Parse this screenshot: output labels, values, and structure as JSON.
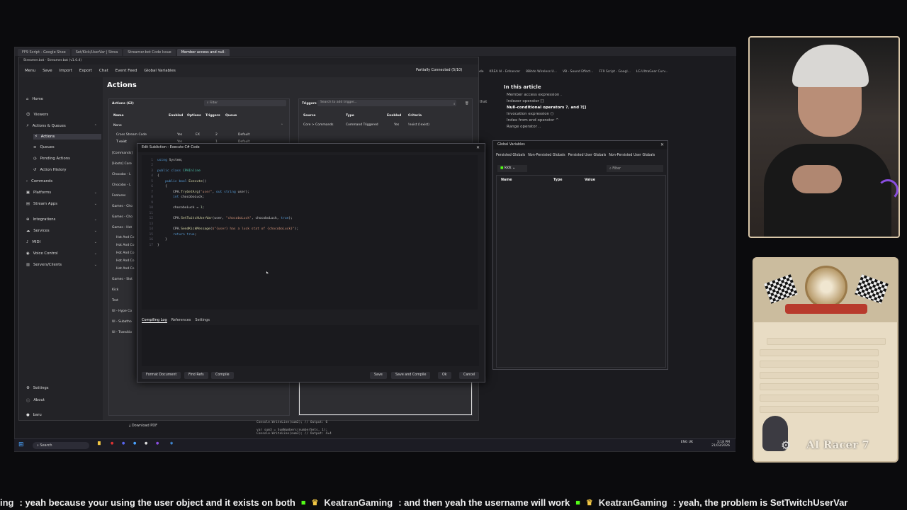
{
  "browser": {
    "tabs": [
      "FF9 Script - Google Shee",
      "Set/Kick/UserVar | Strea",
      "Streamer.bot Code Issue",
      "Member access and null-"
    ],
    "bookmarks": [
      "Code",
      "KREA AI - Enhancer",
      "8Bitdo Wireless U...",
      "VB - Sound Effect...",
      "FF9 Script - Googl...",
      "LG UltraGear Curv..."
    ],
    "article": {
      "heading": "In this article",
      "items": [
        "Member access expression .",
        "Indexer operator []",
        "Null-conditional operators ?. and ?[]",
        "Invocation expression ()",
        "Index from end operator ^",
        "Range operator .."
      ]
    },
    "that_text": "that"
  },
  "streamerbot": {
    "title": "Streamer.bot - Streamer.bot (v1.0.4)",
    "menu": [
      "Menu",
      "Save",
      "Import",
      "Export",
      "Chat",
      "Event Feed",
      "Global Variables"
    ],
    "connection": "Partially Connected (5/10)",
    "sidebar": {
      "home": "Home",
      "viewers": "Viewers",
      "actions_queues": "Actions & Queues",
      "actions": "Actions",
      "queues": "Queues",
      "pending": "Pending Actions",
      "history": "Action History",
      "commands": "Commands",
      "platforms": "Platforms",
      "stream_apps": "Stream Apps",
      "integrations": "Integrations",
      "services": "Services",
      "midi": "MIDI",
      "voice": "Voice Control",
      "servers": "Servers/Clients",
      "settings": "Settings",
      "about": "About",
      "user": "baru"
    },
    "page_title": "Actions",
    "actions_panel": {
      "label": "Actions (62)",
      "filter": "Filter",
      "columns": [
        "Name",
        "Enabled",
        "Options",
        "Triggers",
        "Queue"
      ],
      "group_none": "None",
      "row1": [
        "Cross Stream Code",
        "Yes",
        "EX",
        "2",
        "Default"
      ],
      "row2": [
        "T exist",
        "Yes",
        "",
        "1",
        "Default"
      ],
      "groups": [
        "[Commands]",
        "[Hosts] Core",
        "Chocobo - L",
        "Chocobo - L",
        "Features",
        "Games - Cho",
        "Games - Cho",
        "Games - Hot",
        "Hot And Co",
        "Hot And Co",
        "Hot And Co",
        "Hot And Co",
        "Hot And Co",
        "Games - Slot",
        "Kick",
        "Test",
        "UI - Hype Co",
        "UI - Subatho",
        "UI - Transitio"
      ]
    },
    "triggers_panel": {
      "label": "Triggers",
      "placeholder": "Search to add trigger...",
      "columns": [
        "Source",
        "Type",
        "Enabled",
        "Criteria"
      ],
      "row": [
        "Core > Commands",
        "Command Triggered",
        "Yes",
        "!exist (!exist)"
      ]
    }
  },
  "dialog": {
    "title": "Edit SubAction - Execute C# Code",
    "tabs": [
      "Compiling Log",
      "References",
      "Settings"
    ],
    "buttons": [
      "Format Document",
      "Find Refs",
      "Compile",
      "Save",
      "Save and Compile",
      "Ok",
      "Cancel"
    ]
  },
  "globals": {
    "title": "Global Variables",
    "tabs": [
      "Persisted Globals",
      "Non-Persisted Globals",
      "Persisted User Globals",
      "Non-Persisted User Globals"
    ],
    "platform": "kick",
    "filter": "Filter",
    "columns": [
      "Name",
      "Type",
      "Value"
    ]
  },
  "taskbar": {
    "search": "Search",
    "lang": "ENG UK",
    "time": "3:18 PM",
    "date": "21/03/2026"
  },
  "download": "Download PDF",
  "bgcode": {
    "l1": "Console.WriteLine(sum2); // Output: 6",
    "l2": "var sum3 = SumNumbers(numberSets, 1);",
    "l3": "Console.WriteLine(sum3); // Output: 4+4"
  },
  "card": {
    "name": "AI Racer 7"
  },
  "ticker": {
    "lead_name": "ing",
    "msg1": ": yeah because your using the user object and it exists on both",
    "user2": "KeatranGaming",
    "msg2": ": and then yeah the username will work",
    "user3": "KeatranGaming",
    "msg3": ": yeah, the problem is SetTwitchUserVar"
  },
  "colors": {
    "kick_green": "#53fc18",
    "crown_gold": "#f2c744",
    "accent_purple": "#8a4ee0"
  }
}
